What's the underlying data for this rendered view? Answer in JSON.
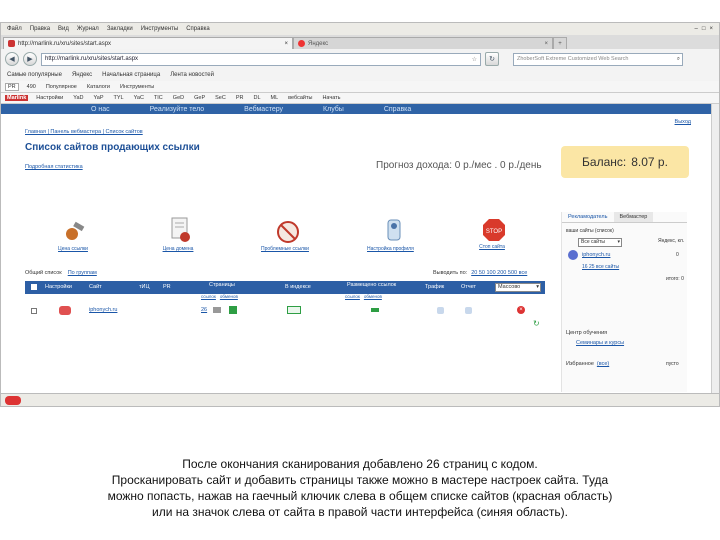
{
  "browser": {
    "menu": [
      "Файл",
      "Правка",
      "Вид",
      "Журнал",
      "Закладки",
      "Инструменты",
      "Справка"
    ],
    "tabs": [
      {
        "label": "http://marlink.ru/xru/sites/start.aspx"
      },
      {
        "label": "Яндекс"
      }
    ],
    "new_tab": "+",
    "nav_icons": [
      "back-icon",
      "forward-icon"
    ],
    "url": "http://marlink.ru/xru/sites/start.aspx",
    "search_placeholder": "ZhoberSoft Extreme Customized Web Search",
    "bookmarks": [
      "Самые популярные",
      "Яндекс",
      "Начальная страница",
      "Лента новостей"
    ],
    "seo_toolbar": [
      "PR",
      "490",
      "Популярное",
      "Каталоги",
      "Инструменты"
    ],
    "seo_toolbar2": [
      "Marlink",
      "Настройки",
      "YaD",
      "YaP",
      "TYL",
      "YaC",
      "TIC",
      "GeD",
      "GeP",
      "SeC",
      "PR",
      "DL",
      "ML",
      "вебсайты",
      "Начать"
    ]
  },
  "site": {
    "topnav": [
      "О нас",
      "Реализуйте тело",
      "Вебмастеру",
      "Клубы",
      "Справка"
    ],
    "breadcrumb": "Главная | Панель вебмастера | Список сайтов",
    "page_title": "Список сайтов продающих ссылки",
    "stats_link": "Подробная статистика",
    "forecast_label": "Прогноз дохода:",
    "forecast_value": "0 р./мес . 0 р./день",
    "balance_label": "Баланс:",
    "balance_value": "8.07 р.",
    "logout": "Выход",
    "tools": [
      {
        "label": "Цена ссылки",
        "icon": "wrench-icon"
      },
      {
        "label": "Цена домена",
        "icon": "document-icon"
      },
      {
        "label": "Проблемные ссылки",
        "icon": "no-entry-icon"
      },
      {
        "label": "Настройка профиля",
        "icon": "profile-icon"
      },
      {
        "label": "Стоп сайта",
        "icon": "stop-icon"
      }
    ],
    "filter_label": "Общий список",
    "filter_link": "По группам",
    "pagination": "Выводить по:",
    "pagination_opts": "20 50 100 200 500 все",
    "table_headers": [
      "Настройки",
      "Сайт",
      "тИЦ",
      "PR",
      "Страницы",
      "В индексе",
      "Размещено ссылок",
      "Трафик",
      "Отчет"
    ],
    "subheaders": [
      "ссылок",
      "обменов",
      "ссылок",
      "обменов"
    ],
    "select_value": "Массово",
    "row": {
      "site": "iphonych.ru",
      "pages": "26"
    },
    "side": {
      "tabs": [
        "Рекламодатель",
        "Вебмастер"
      ],
      "my_sites": "ваши сайты (список)",
      "site_select": "Все сайты",
      "site_name": "iphonych.ru",
      "indexed_label": "Яндекс, кл.",
      "indexed_val": "0",
      "pages_link": "16 25 все сайты",
      "total": "итого:",
      "total_val": "0",
      "learning": "Центр обучения",
      "seminars": "Семинары и курсы",
      "favorites": "Избранное",
      "favorites_link": "(все)",
      "favorites_empty": "пусто"
    }
  },
  "caption_lines": [
    "После окончания сканирования  добавлено 26 страниц с кодом.",
    "Просканировать сайт и добавить страницы также можно в мастере настроек сайта. Туда",
    "можно попасть, нажав на гаечный ключик слева в общем списке сайтов (красная область)",
    "или на значок слева от сайта в правой части интерфейса (синяя область)."
  ]
}
